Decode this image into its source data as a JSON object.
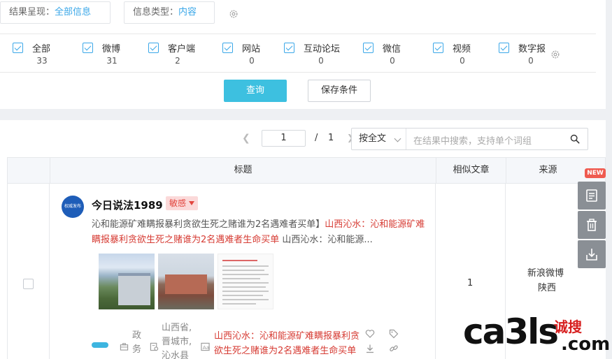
{
  "filters": {
    "result_display": {
      "label": "结果呈现：",
      "value": "全部信息"
    },
    "info_type": {
      "label": "信息类型：",
      "value": "内容"
    }
  },
  "sources": [
    {
      "label": "全部",
      "count": "33"
    },
    {
      "label": "微博",
      "count": "31"
    },
    {
      "label": "客户端",
      "count": "2"
    },
    {
      "label": "网站",
      "count": "0"
    },
    {
      "label": "互动论坛",
      "count": "0"
    },
    {
      "label": "微信",
      "count": "0"
    },
    {
      "label": "视频",
      "count": "0"
    },
    {
      "label": "数字报",
      "count": "0"
    }
  ],
  "buttons": {
    "query": "查询",
    "save": "保存条件"
  },
  "pager": {
    "current": "1",
    "separator": "/",
    "total": "1"
  },
  "search": {
    "mode": "按全文",
    "placeholder": "在结果中搜索，支持单个词组"
  },
  "table": {
    "headers": {
      "title": "标题",
      "similar": "相似文章",
      "source": "来源"
    }
  },
  "article": {
    "avatar_text": "权威发布",
    "author": "今日说法1989",
    "tag": "敏感",
    "summary_plain": "沁和能源矿难瞒报暴利贪欲生死之赌谁为2名遇难者买单】",
    "summary_highlight": "山西沁水：沁和能源矿难瞒报暴利贪欲生死之赌谁为2名遇难者生命买单",
    "summary_tail": " 山西沁水：沁和能源...",
    "meta_category": "政务",
    "meta_location": "山西省,晋城市,沁水县",
    "meta_keyword": "山西沁水：沁和能源矿难瞒报暴利贪欲生死之赌谁为2名遇难者生命买单",
    "similar_count": "1",
    "source_name": "新浪微博",
    "source_region": "陕西"
  },
  "side_tools": {
    "new_badge": "NEW"
  },
  "watermark": {
    "latin": "ca3ls",
    "cn": "诚搜",
    "com": ".com"
  },
  "icons": [
    "gear-icon",
    "checkbox-icon",
    "search-icon",
    "chevron-left-icon",
    "chevron-right-icon",
    "chevron-down-icon",
    "briefcase-icon",
    "location-icon",
    "keyword-icon",
    "heart-icon",
    "tag-icon",
    "download-icon",
    "link-icon",
    "report-icon",
    "trash-icon",
    "export-icon"
  ],
  "colors": {
    "accent": "#3aa7e8",
    "primary_button": "#3dc0e0",
    "highlight_red": "#d63a32",
    "sensitive_bg": "#fbd9d9",
    "side_tool": "#8a8f95"
  }
}
